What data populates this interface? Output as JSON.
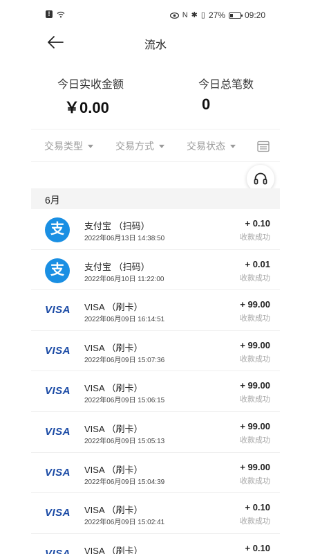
{
  "status_bar": {
    "battery": "27%",
    "time": "09:20"
  },
  "header": {
    "title": "流水"
  },
  "summary": {
    "amount_label": "今日实收金额",
    "amount_value": "￥0.00",
    "count_label": "今日总笔数",
    "count_value": "0"
  },
  "filters": {
    "type": "交易类型",
    "method": "交易方式",
    "status": "交易状态"
  },
  "month": "6月",
  "transactions": [
    {
      "icon": "alipay-icon",
      "name": "支付宝 （扫码）",
      "time": "2022年06月13日 14:38:50",
      "amount": "+ 0.10",
      "status": "收款成功"
    },
    {
      "icon": "alipay-icon",
      "name": "支付宝 （扫码）",
      "time": "2022年06月10日 11:22:00",
      "amount": "+ 0.01",
      "status": "收款成功"
    },
    {
      "icon": "visa-icon",
      "name": "VISA （刷卡）",
      "time": "2022年06月09日 16:14:51",
      "amount": "+ 99.00",
      "status": "收款成功"
    },
    {
      "icon": "visa-icon",
      "name": "VISA （刷卡）",
      "time": "2022年06月09日 15:07:36",
      "amount": "+ 99.00",
      "status": "收款成功"
    },
    {
      "icon": "visa-icon",
      "name": "VISA （刷卡）",
      "time": "2022年06月09日 15:06:15",
      "amount": "+ 99.00",
      "status": "收款成功"
    },
    {
      "icon": "visa-icon",
      "name": "VISA （刷卡）",
      "time": "2022年06月09日 15:05:13",
      "amount": "+ 99.00",
      "status": "收款成功"
    },
    {
      "icon": "visa-icon",
      "name": "VISA （刷卡）",
      "time": "2022年06月09日 15:04:39",
      "amount": "+ 99.00",
      "status": "收款成功"
    },
    {
      "icon": "visa-icon",
      "name": "VISA （刷卡）",
      "time": "2022年06月09日 15:02:41",
      "amount": "+ 0.10",
      "status": "收款成功"
    },
    {
      "icon": "visa-icon",
      "name": "VISA （刷卡）",
      "time": "",
      "amount": "+ 0.10",
      "status": ""
    }
  ],
  "visa_text": "VISA",
  "alipay_glyph": "支"
}
